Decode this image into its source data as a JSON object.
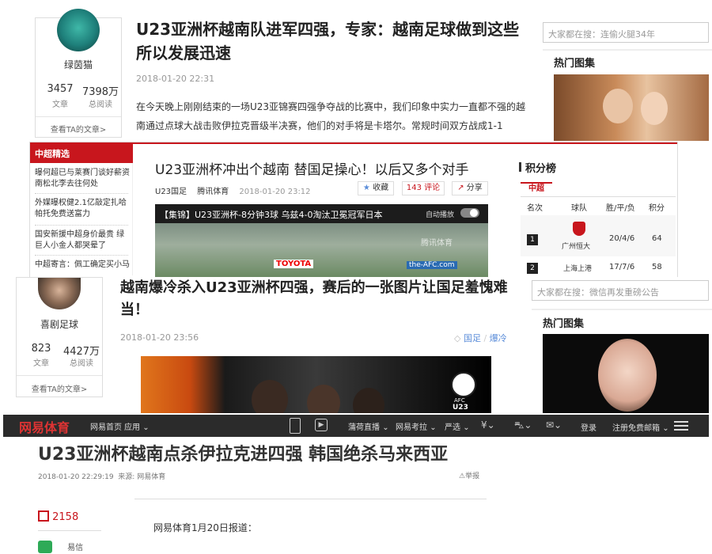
{
  "shot1": {
    "author_name": "绿茵猫",
    "stats": [
      {
        "value": "3457",
        "label": "文章"
      },
      {
        "value": "7398万",
        "label": "总阅读"
      }
    ],
    "view_articles": "查看TA的文章>",
    "title": "U23亚洲杯越南队进军四强，专家：越南足球做到这些所以发展迅速",
    "date": "2018-01-20 22:31",
    "body": "在今天晚上刚刚结束的一场U23亚锦赛四强争夺战的比赛中，我们印象中实力一直都不强的越南通过点球大战击败伊拉克晋级半决赛，他们的对手将是卡塔尔。常规时间双方战成1-1",
    "search_placeholder": "大家都在搜：连偷火腿34年",
    "hot_gallery": "热门图集"
  },
  "shot2": {
    "sidebar_header": "中超精选",
    "sidebar_items": [
      "曝何超已与莱赛门谈好薪资 南松北李去往何处",
      "外媒曝权健2.1亿敲定扎哈 帕托免费送富力",
      "国安新援中超身价最贵 绿巨人小金人都哭晕了",
      "中超寄言：佩工确定买小马"
    ],
    "title": "U23亚洲杯冲出个越南 替国足操心！以后又多个对手",
    "meta_tag1": "U23国足",
    "meta_source": "腾讯体育",
    "date": "2018-01-20 23:12",
    "btn_collect": "收藏",
    "btn_comment": "143 评论",
    "btn_share": "分享",
    "video_title": "【集锦】U23亚洲杯-8分钟3球 乌兹4-0淘汰卫冕冠军日本",
    "autoplay": "自动播放",
    "watermark": "腾讯体育",
    "ad_text": "TOYOTA",
    "ad_text2": "the-AFC.com",
    "standings_title": "积分榜",
    "standings_tab": "中超",
    "standings_headers": [
      "名次",
      "球队",
      "胜/平/负",
      "积分"
    ],
    "standings_rows": [
      {
        "rank": "1",
        "team": "广州恒大",
        "record": "20/4/6",
        "points": "64"
      },
      {
        "rank": "2",
        "team": "上海上港",
        "record": "17/7/6",
        "points": "58"
      }
    ]
  },
  "shot3": {
    "author_name": "喜剧足球",
    "stats": [
      {
        "value": "823",
        "label": "文章"
      },
      {
        "value": "4427万",
        "label": "总阅读"
      }
    ],
    "view_articles": "查看TA的文章>",
    "title": "越南爆冷杀入U23亚洲杯四强，赛后的一张图片让国足羞愧难当！",
    "date": "2018-01-20 23:56",
    "tags": [
      "国足",
      "爆冷"
    ],
    "search_placeholder": "大家都在搜：微信再发重磅公告",
    "hot_gallery": "热门图集",
    "afc_label": "AFC",
    "afc_sub": "U23"
  },
  "shot4": {
    "logo_main": "网易",
    "logo_sub": "体育",
    "nav": [
      "网易首页",
      "应用"
    ],
    "nav_right": [
      "蒲荷直播",
      "网易考拉",
      "严选",
      "登录",
      "注册免费邮箱"
    ],
    "title": "U23亚洲杯越南点杀伊拉克进四强 韩国绝杀马来西亚",
    "meta": "2018-01-20 22:29:19  来源: 网易体育",
    "report": "举报",
    "comment_count": "2158",
    "side_label": "易信",
    "lead": "网易体育1月20日报道："
  },
  "colors": {
    "red": "#c8161d",
    "netease_bar": "#2b2b2b",
    "blue": "#5b8dd9"
  }
}
